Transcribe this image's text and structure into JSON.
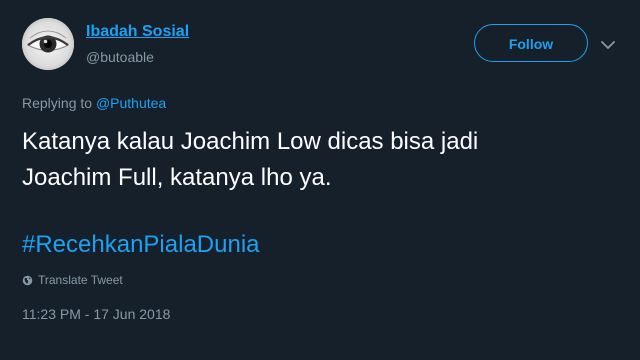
{
  "user": {
    "name": "Ibadah Sosial",
    "handle": "@butoable"
  },
  "follow_button": {
    "label": "Follow"
  },
  "reply": {
    "prefix": "Replying to ",
    "mention": "@Puthutea"
  },
  "tweet": {
    "line1": "Katanya kalau Joachim Low dicas bisa jadi",
    "line2": "Joachim Full, katanya lho ya.",
    "hashtag": "#RecehkanPialaDunia"
  },
  "translate": {
    "label": "Translate Tweet"
  },
  "timestamp": "11:23 PM - 17 Jun 2018",
  "colors": {
    "background": "#15202b",
    "accent": "#1da1f2",
    "secondary_text": "#8899a6",
    "primary_text": "#ffffff"
  },
  "icons": {
    "avatar": "eye-avatar",
    "menu": "chevron-down-icon",
    "translate": "globe-icon"
  }
}
